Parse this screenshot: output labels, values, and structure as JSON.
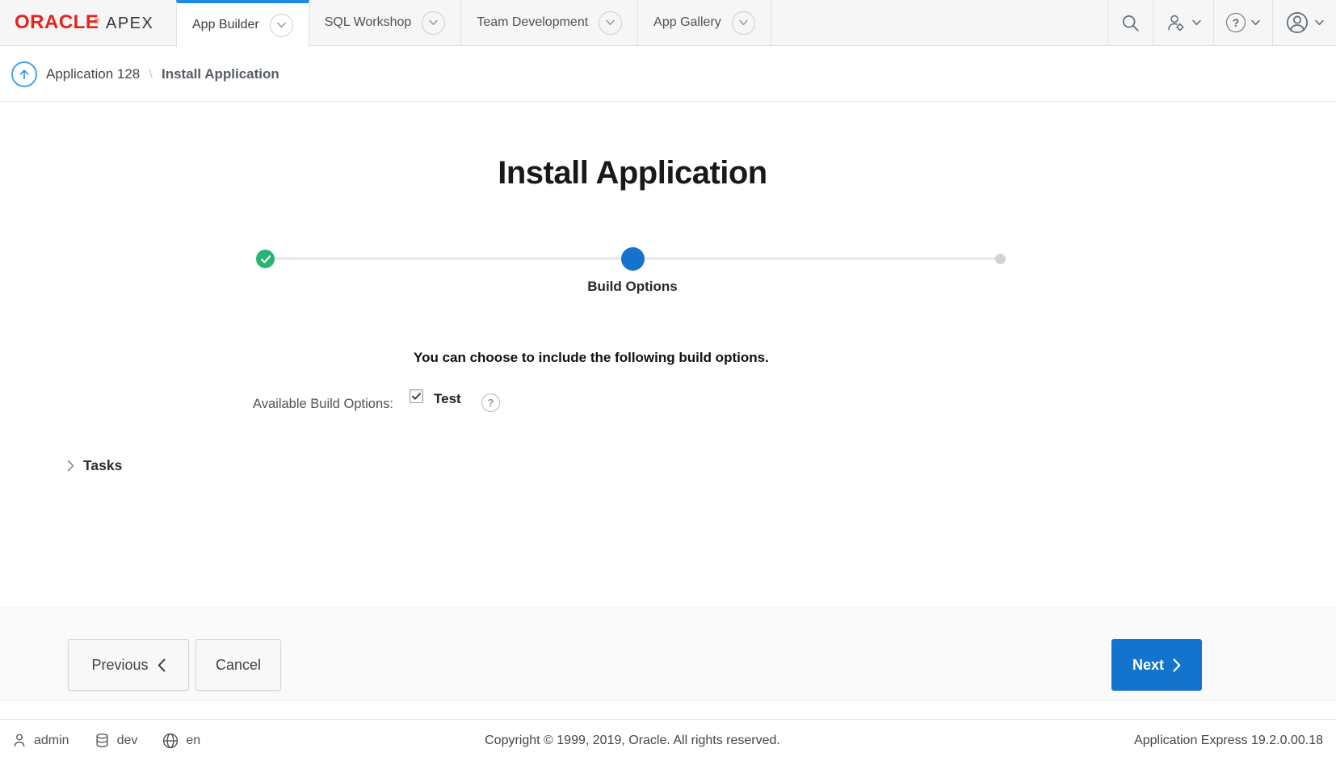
{
  "header": {
    "logo": {
      "brand": "ORACLE",
      "registered": "®",
      "product": "APEX"
    },
    "tabs": [
      {
        "label": "App Builder",
        "active": true
      },
      {
        "label": "SQL Workshop",
        "active": false
      },
      {
        "label": "Team Development",
        "active": false
      },
      {
        "label": "App Gallery",
        "active": false
      }
    ],
    "icon_buttons": [
      "search-icon",
      "admin-tools-icon",
      "help-icon",
      "account-icon"
    ]
  },
  "breadcrumb": {
    "up_label": "Application 128",
    "separator": "\\",
    "current": "Install Application"
  },
  "main": {
    "title": "Install Application",
    "wizard": {
      "steps": [
        {
          "state": "complete"
        },
        {
          "state": "current",
          "label": "Build Options"
        },
        {
          "state": "upcoming"
        }
      ],
      "current_step_label": "Build Options"
    },
    "instruction": "You can choose to include the following build options.",
    "form": {
      "label": "Available Build Options:",
      "checkbox": {
        "label": "Test",
        "checked": true
      }
    },
    "tasks_label": "Tasks"
  },
  "buttons": {
    "previous": "Previous",
    "cancel": "Cancel",
    "next": "Next"
  },
  "footer": {
    "user": "admin",
    "database": "dev",
    "language": "en",
    "copyright": "Copyright © 1999, 2019, Oracle. All rights reserved.",
    "version": "Application Express 19.2.0.00.18"
  },
  "icons": {
    "help_glyph": "?"
  },
  "colors": {
    "accent_blue": "#1373cd",
    "tab_highlight_blue": "#1e8ae6",
    "oracle_red": "#e8231d",
    "success_green": "#28b473",
    "breadcrumb_circle_blue": "#4aa3ea"
  }
}
